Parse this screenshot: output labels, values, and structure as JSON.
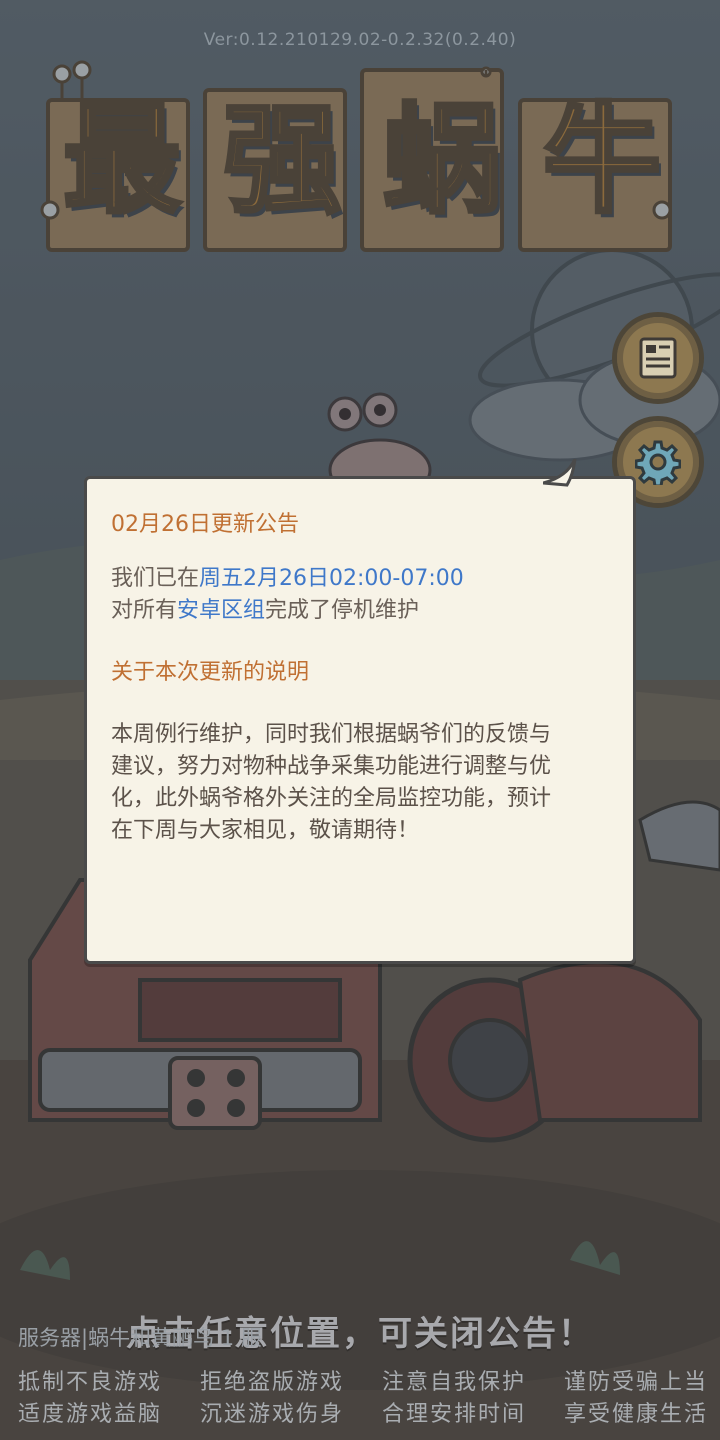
{
  "version": "Ver:0.12.210129.02-0.2.32(0.2.40)",
  "logo": {
    "chars": [
      "最",
      "强",
      "蜗",
      "牛"
    ]
  },
  "side_buttons": [
    {
      "icon": "notice-board-icon"
    },
    {
      "icon": "gear-icon"
    }
  ],
  "notice": {
    "title": "02月26日更新公告",
    "line1_pre": "我们已在",
    "line1_time": "周五2月26日02:00-07:00",
    "line2_pre": "对所有",
    "line2_group": "安卓区组",
    "line2_post": "完成了停机维护",
    "section_title": "关于本次更新的说明",
    "paragraph_lines": [
      "本周例行维护，同时我们根据蜗爷们的反馈与",
      "建议，努力对物种战争采集功能进行调整与优",
      "化，此外蜗爷格外关注的全局监控功能，预计",
      "在下周与大家相见，敬请期待！"
    ]
  },
  "close_hint": "点击任意位置，可关闭公告！",
  "server_text": "服务器|蜗牛和黄鹂鸟 1 服",
  "health_lines": [
    [
      "抵制不良游戏",
      "拒绝盗版游戏",
      "注意自我保护",
      "谨防受骗上当"
    ],
    [
      "适度游戏益脑",
      "沉迷游戏伤身",
      "合理安排时间",
      "享受健康生活"
    ]
  ],
  "colors": {
    "notice_bg": "#f7f3e7",
    "title_orange": "#c07033",
    "highlight_blue": "#3f78c9",
    "body_text": "#5c524a"
  }
}
